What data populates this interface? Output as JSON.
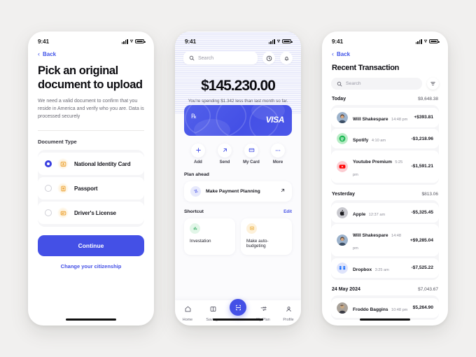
{
  "phone1": {
    "status": {
      "time": "9:41"
    },
    "back_label": "Back",
    "title": "Pick an original document to upload",
    "subtitle": "We need a valid document to confirm that you reside in America and verify who you are. Data is processed securely",
    "section_label": "Document Type",
    "options": [
      {
        "label": "National Identity Card",
        "selected": true,
        "icon": "id-card-icon"
      },
      {
        "label": "Passport",
        "selected": false,
        "icon": "passport-icon"
      },
      {
        "label": "Driver's License",
        "selected": false,
        "icon": "drivers-license-icon"
      }
    ],
    "continue_label": "Continue",
    "change_link": "Change your citizenship"
  },
  "phone2": {
    "status": {
      "time": "9:41"
    },
    "search_placeholder": "Search",
    "history_icon": "history-clock-icon",
    "bell_icon": "notification-bell-icon",
    "balance": "$145.230.00",
    "balance_note": "You're spending $1.342 less than last month so far.",
    "card": {
      "brand": "VISA",
      "contactless_icon": "contactless-icon",
      "color": "#4450e6"
    },
    "actions": [
      {
        "label": "Add",
        "icon": "plus-icon"
      },
      {
        "label": "Send",
        "icon": "arrow-up-right-icon"
      },
      {
        "label": "My Card",
        "icon": "credit-card-icon"
      },
      {
        "label": "More",
        "icon": "ellipsis-icon"
      }
    ],
    "plan_section": "Plan ahead",
    "plan_item": {
      "label": "Make Payment Planning",
      "icon": "transfer-icon",
      "arrow": "arrow-up-right-icon"
    },
    "shortcut_section": "Shortcut",
    "shortcut_edit": "Edit",
    "shortcuts": [
      {
        "label": "Investation",
        "icon": "bar-chart-icon",
        "color": "#2faa5e"
      },
      {
        "label": "Make auto-budgeting",
        "icon": "budget-icon",
        "color": "#e8a52a"
      }
    ],
    "tabs": [
      {
        "label": "Home",
        "icon": "home-icon",
        "active": false
      },
      {
        "label": "Savings",
        "icon": "savings-icon",
        "active": false
      },
      {
        "label": "",
        "icon": "scan-icon",
        "active": true
      },
      {
        "label": "My Plan",
        "icon": "my-plan-icon",
        "active": false
      },
      {
        "label": "Profile",
        "icon": "profile-icon",
        "active": false
      }
    ]
  },
  "phone3": {
    "status": {
      "time": "9:41"
    },
    "back_label": "Back",
    "title": "Recent Transaction",
    "search_placeholder": "Search",
    "filter_icon": "filter-icon",
    "groups": [
      {
        "date": "Today",
        "total": "$9,648.38",
        "items": [
          {
            "name": "Will Shakespare",
            "time": "14:48 pm",
            "amount": "+$393.81",
            "avatar": "photo-avatar-1"
          },
          {
            "name": "Spotify",
            "time": "4:10 am",
            "amount": "-$3,218.96",
            "avatar": "spotify-icon"
          },
          {
            "name": "Youtube Premium",
            "time": "5:25 pm",
            "amount": "-$1,591.21",
            "avatar": "youtube-icon"
          }
        ]
      },
      {
        "date": "Yesterday",
        "total": "$813.06",
        "items": [
          {
            "name": "Apple",
            "time": "12:37 am",
            "amount": "-$5,325.45",
            "avatar": "apple-icon"
          },
          {
            "name": "Will Shakespare",
            "time": "14:48 pm",
            "amount": "+$9,285.04",
            "avatar": "photo-avatar-1"
          },
          {
            "name": "Dropbox",
            "time": "3:25 am",
            "amount": "-$7,525.22",
            "avatar": "dropbox-icon"
          }
        ]
      },
      {
        "date": "24 May 2024",
        "total": "$7,043.67",
        "items": [
          {
            "name": "Froddo Baggins",
            "time": "10:48 pm",
            "amount": "$5,264.90",
            "avatar": "photo-avatar-2"
          }
        ]
      }
    ]
  }
}
